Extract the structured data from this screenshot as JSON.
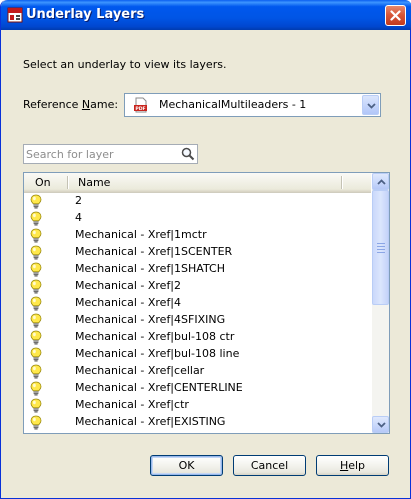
{
  "window": {
    "title": "Underlay Layers"
  },
  "dialog": {
    "instruction": "Select an underlay to view its layers.",
    "reference_label_prefix": "Reference ",
    "reference_label_accel": "N",
    "reference_label_suffix": "ame:",
    "reference_value": "MechanicalMultileaders - 1",
    "reference_icon": "pdf-icon",
    "search_placeholder": "Search for layer",
    "search_value": ""
  },
  "layer_list": {
    "columns": [
      "On",
      "Name"
    ],
    "rows": [
      {
        "on": true,
        "name": "2"
      },
      {
        "on": true,
        "name": "4"
      },
      {
        "on": true,
        "name": "Mechanical - Xref|1mctr"
      },
      {
        "on": true,
        "name": "Mechanical - Xref|1SCENTER"
      },
      {
        "on": true,
        "name": "Mechanical - Xref|1SHATCH"
      },
      {
        "on": true,
        "name": "Mechanical - Xref|2"
      },
      {
        "on": true,
        "name": "Mechanical - Xref|4"
      },
      {
        "on": true,
        "name": "Mechanical - Xref|4SFIXING"
      },
      {
        "on": true,
        "name": "Mechanical - Xref|bul-108 ctr"
      },
      {
        "on": true,
        "name": "Mechanical - Xref|bul-108 line"
      },
      {
        "on": true,
        "name": "Mechanical - Xref|cellar"
      },
      {
        "on": true,
        "name": "Mechanical - Xref|CENTERLINE"
      },
      {
        "on": true,
        "name": "Mechanical - Xref|ctr"
      },
      {
        "on": true,
        "name": "Mechanical - Xref|EXISTING"
      }
    ]
  },
  "buttons": {
    "ok": "OK",
    "cancel": "Cancel",
    "help_accel": "H",
    "help_rest": "elp"
  },
  "colors": {
    "titlebar": "#0055e5",
    "dialog_bg": "#ece9d8",
    "bulb_on": "#ffe84a"
  }
}
